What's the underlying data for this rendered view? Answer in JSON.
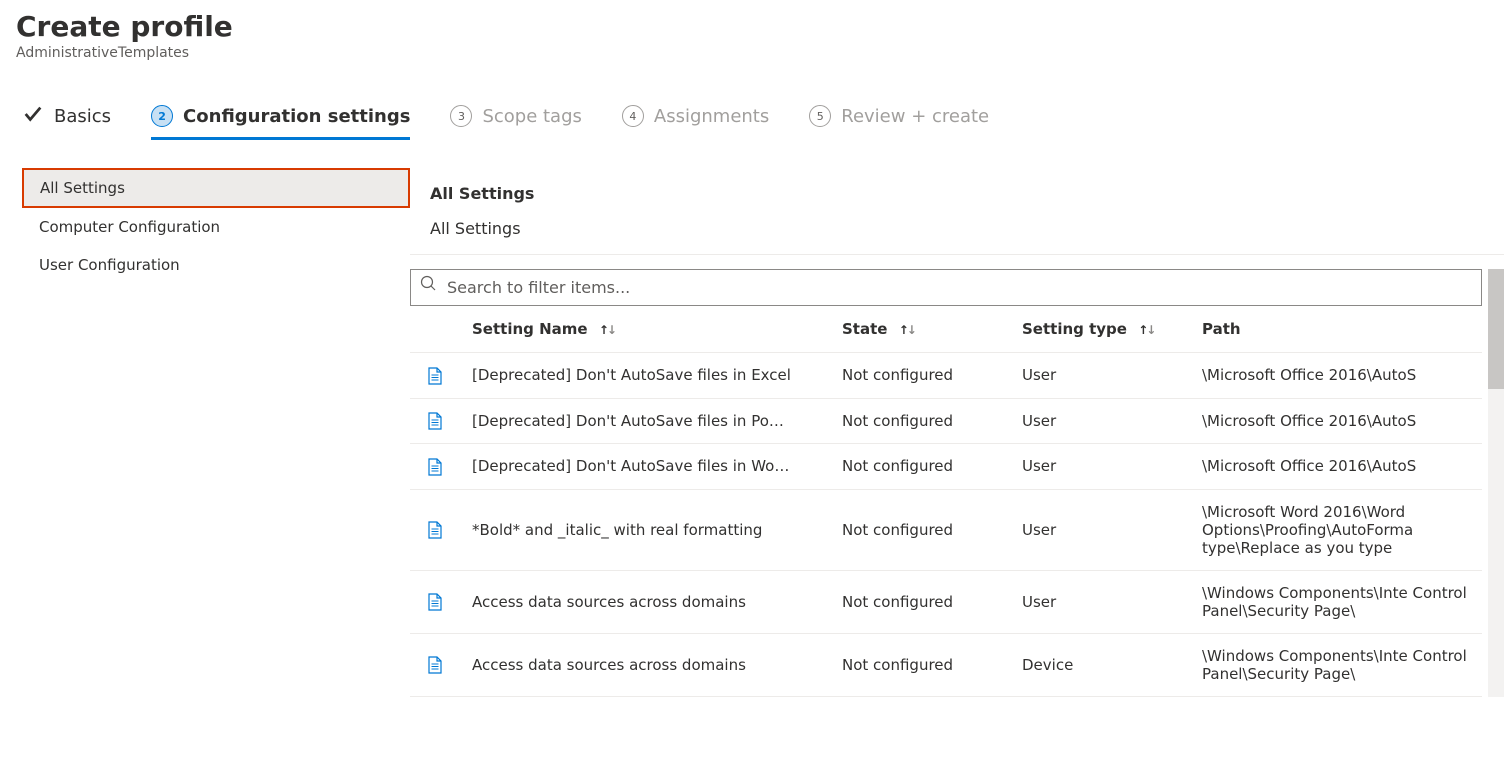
{
  "header": {
    "title": "Create profile",
    "subtitle": "AdministrativeTemplates"
  },
  "steps": {
    "basics": "Basics",
    "config": "Configuration settings",
    "scope": "Scope tags",
    "assign": "Assignments",
    "review": "Review + create",
    "num2": "2",
    "num3": "3",
    "num4": "4",
    "num5": "5"
  },
  "sidebar": {
    "items": [
      {
        "label": "All Settings"
      },
      {
        "label": "Computer Configuration"
      },
      {
        "label": "User Configuration"
      }
    ]
  },
  "content": {
    "heading": "All Settings",
    "breadcrumb": "All Settings"
  },
  "search": {
    "placeholder": "Search to filter items..."
  },
  "table": {
    "headers": {
      "name": "Setting Name",
      "state": "State",
      "type": "Setting type",
      "path": "Path"
    },
    "rows": [
      {
        "name": "[Deprecated] Don't AutoSave files in Excel",
        "state": "Not configured",
        "type": "User",
        "path": "\\Microsoft Office 2016\\AutoS"
      },
      {
        "name": "[Deprecated] Don't AutoSave files in Po…",
        "state": "Not configured",
        "type": "User",
        "path": "\\Microsoft Office 2016\\AutoS"
      },
      {
        "name": "[Deprecated] Don't AutoSave files in Wo…",
        "state": "Not configured",
        "type": "User",
        "path": "\\Microsoft Office 2016\\AutoS"
      },
      {
        "name": "*Bold* and _italic_ with real formatting",
        "state": "Not configured",
        "type": "User",
        "path": "\\Microsoft Word 2016\\Word Options\\Proofing\\AutoForma type\\Replace as you type"
      },
      {
        "name": "Access data sources across domains",
        "state": "Not configured",
        "type": "User",
        "path": "\\Windows Components\\Inte Control Panel\\Security Page\\"
      },
      {
        "name": "Access data sources across domains",
        "state": "Not configured",
        "type": "Device",
        "path": "\\Windows Components\\Inte Control Panel\\Security Page\\"
      }
    ]
  }
}
